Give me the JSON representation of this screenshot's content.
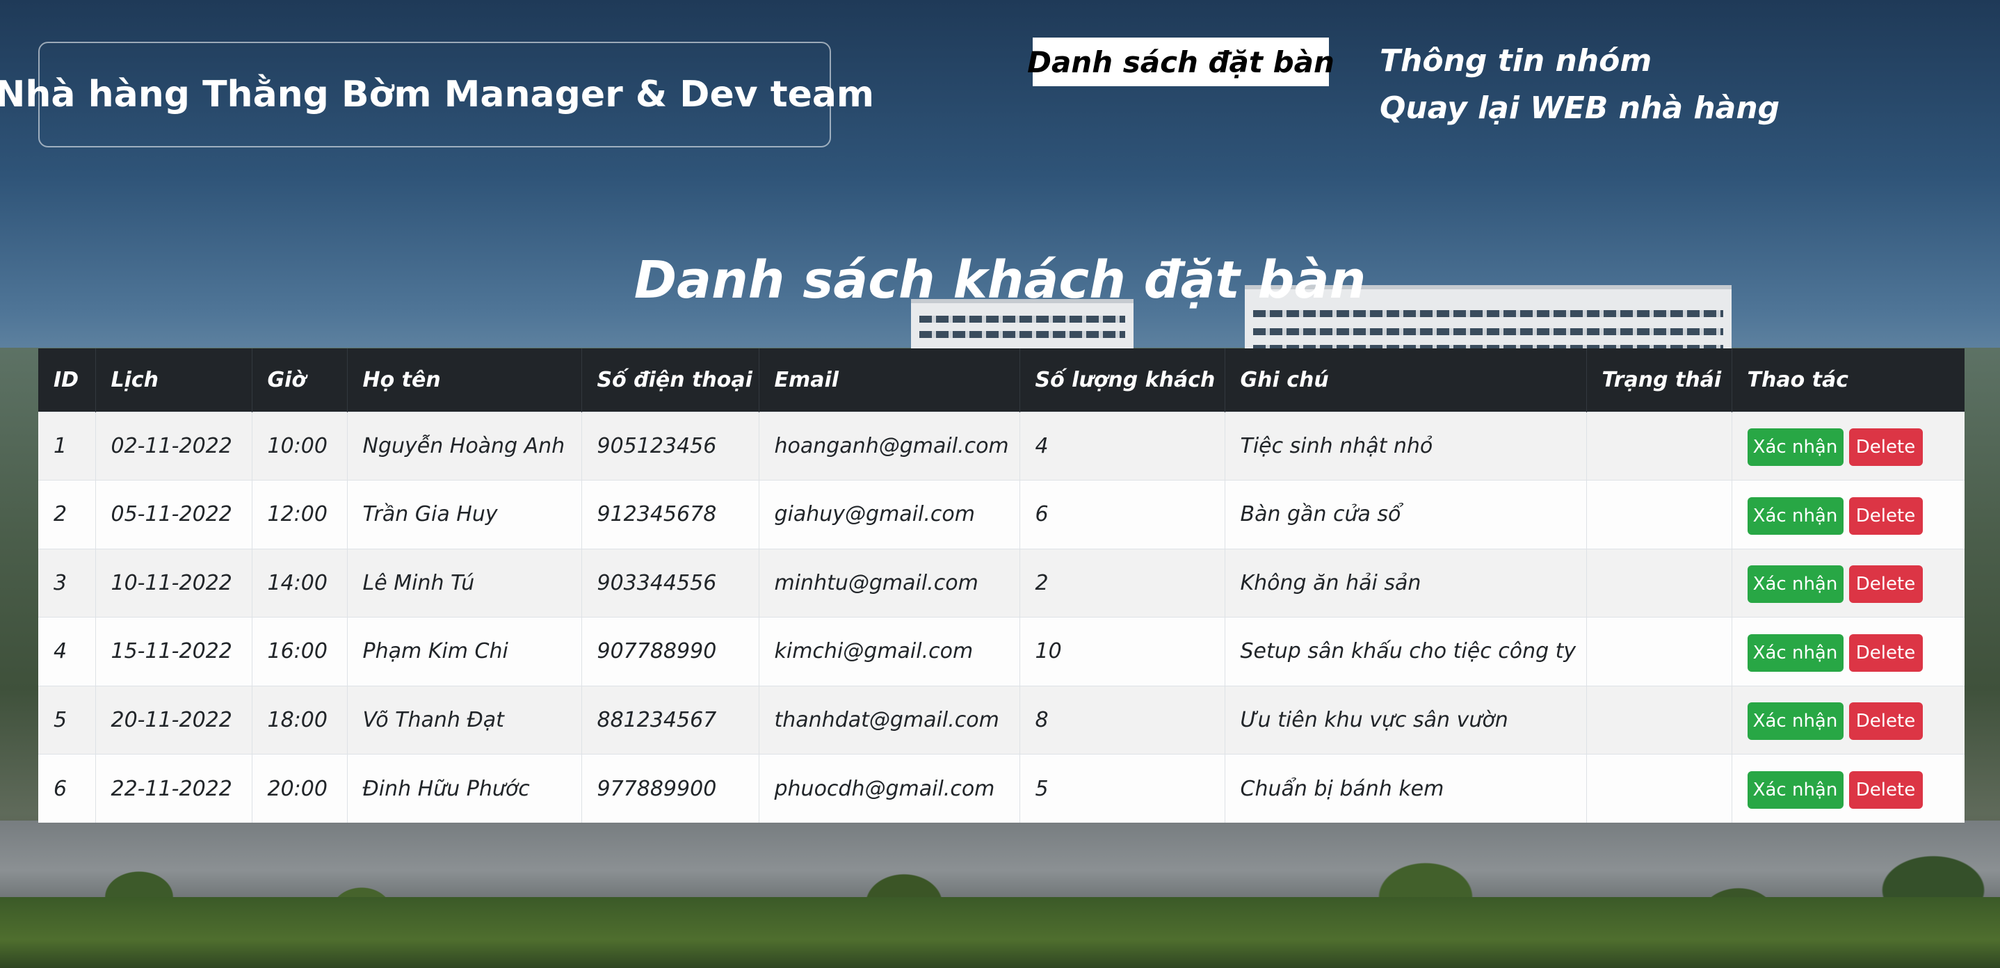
{
  "header": {
    "brand_title": "Nhà hàng Thằng Bờm Manager & Dev team",
    "nav": {
      "booking_list": "Danh sách đặt bàn",
      "team_info": "Thông tin nhóm",
      "back_to_web": "Quay lại WEB nhà hàng"
    }
  },
  "main": {
    "heading": "Danh sách khách đặt bàn",
    "table": {
      "columns": [
        "ID",
        "Lịch",
        "Giờ",
        "Họ tên",
        "Số điện thoại",
        "Email",
        "Số lượng khách",
        "Ghi chú",
        "Trạng thái",
        "Thao tác"
      ],
      "rows": [
        {
          "id": "1",
          "date": "02-11-2022",
          "time": "10:00",
          "name": "Nguyễn Hoàng Anh",
          "phone": "905123456",
          "email": "hoanganh@gmail.com",
          "guests": "4",
          "note": "Tiệc sinh nhật nhỏ",
          "status": ""
        },
        {
          "id": "2",
          "date": "05-11-2022",
          "time": "12:00",
          "name": "Trần Gia Huy",
          "phone": "912345678",
          "email": "giahuy@gmail.com",
          "guests": "6",
          "note": "Bàn gần cửa sổ",
          "status": ""
        },
        {
          "id": "3",
          "date": "10-11-2022",
          "time": "14:00",
          "name": "Lê Minh Tú",
          "phone": "903344556",
          "email": "minhtu@gmail.com",
          "guests": "2",
          "note": "Không ăn hải sản",
          "status": ""
        },
        {
          "id": "4",
          "date": "15-11-2022",
          "time": "16:00",
          "name": "Phạm Kim Chi",
          "phone": "907788990",
          "email": "kimchi@gmail.com",
          "guests": "10",
          "note": "Setup sân khấu cho tiệc công ty",
          "status": ""
        },
        {
          "id": "5",
          "date": "20-11-2022",
          "time": "18:00",
          "name": "Võ Thanh Đạt",
          "phone": "881234567",
          "email": "thanhdat@gmail.com",
          "guests": "8",
          "note": "Ưu tiên khu vực sân vườn",
          "status": ""
        },
        {
          "id": "6",
          "date": "22-11-2022",
          "time": "20:00",
          "name": "Đinh Hữu Phước",
          "phone": "977889900",
          "email": "phuocdh@gmail.com",
          "guests": "5",
          "note": "Chuẩn bị bánh kem",
          "status": ""
        }
      ],
      "actions": {
        "confirm_label": "Xác nhận",
        "delete_label": "Delete"
      }
    }
  },
  "colors": {
    "header_row": "#212529",
    "confirm_button": "#28a745",
    "delete_button": "#dc3545",
    "row_odd": "#f2f2f2",
    "row_even": "#fdfdfd"
  }
}
